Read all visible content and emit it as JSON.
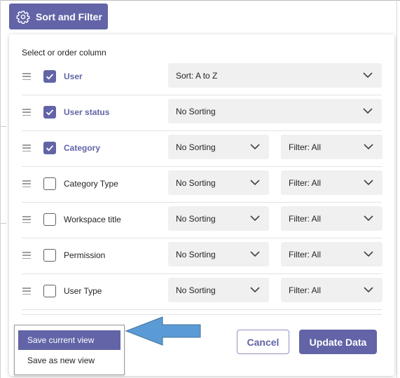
{
  "toolbar": {
    "sort_filter_label": "Sort and Filter",
    "icon": "gear-icon",
    "accent": "#6264a7"
  },
  "panel": {
    "title": "Select or order column",
    "rows": [
      {
        "column": "User",
        "checked": true,
        "sort": "Sort: A to Z",
        "filter": null
      },
      {
        "column": "User status",
        "checked": true,
        "sort": "No Sorting",
        "filter": null
      },
      {
        "column": "Category",
        "checked": true,
        "sort": "No Sorting",
        "filter": "Filter: All"
      },
      {
        "column": "Category Type",
        "checked": false,
        "sort": "No Sorting",
        "filter": "Filter: All"
      },
      {
        "column": "Workspace title",
        "checked": false,
        "sort": "No Sorting",
        "filter": "Filter: All"
      },
      {
        "column": "Permission",
        "checked": false,
        "sort": "No Sorting",
        "filter": "Filter: All"
      },
      {
        "column": "User Type",
        "checked": false,
        "sort": "No Sorting",
        "filter": "Filter: All"
      }
    ]
  },
  "footer": {
    "cancel_label": "Cancel",
    "update_label": "Update Data"
  },
  "save_menu": {
    "items": [
      {
        "label": "Save current view",
        "active": true
      },
      {
        "label": "Save as new view",
        "active": false
      }
    ]
  },
  "callout": {
    "icon": "arrow-left-icon",
    "color": "#5b9bd5"
  }
}
